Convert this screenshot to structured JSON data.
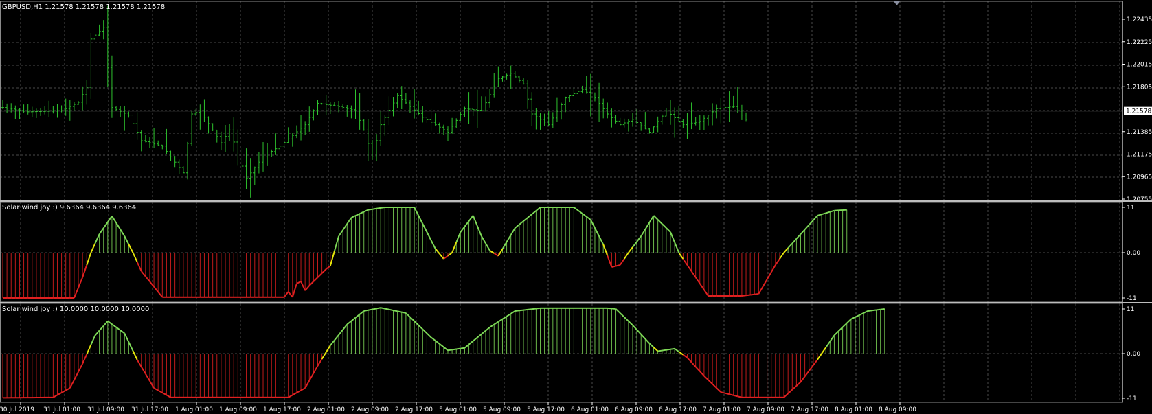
{
  "header": {
    "symbol_line": "GBPUSD,H1  1.21578 1.21578 1.21578 1.21578"
  },
  "colors": {
    "background": "#000000",
    "grid": "#4a4a4a",
    "price_bar": "#2ec42e",
    "positive": "#7ed957",
    "negative": "#e02020",
    "transition": "#e6e60a",
    "axis_text": "#ffffff",
    "price_tag_bg": "#ffffff",
    "price_tag_text": "#000000"
  },
  "price_panel": {
    "current_price": "1.21578",
    "price_ticks": [
      "1.22435",
      "1.22225",
      "1.22015",
      "1.21805",
      "1.21385",
      "1.21175",
      "1.20965",
      "1.20755"
    ]
  },
  "indicator_panels": [
    {
      "label": "Solar wind joy :) 9.6364 9.6364 9.6364",
      "ticks": [
        "11",
        "0.00",
        "-11"
      ]
    },
    {
      "label": "Solar wind joy :) 10.0000 10.0000 10.0000",
      "ticks": [
        "11",
        "0.00",
        "-11"
      ]
    }
  ],
  "time_axis": {
    "labels": [
      "30 Jul 2019",
      "31 Jul 01:00",
      "31 Jul 09:00",
      "31 Jul 17:00",
      "1 Aug 01:00",
      "1 Aug 09:00",
      "1 Aug 17:00",
      "2 Aug 01:00",
      "2 Aug 09:00",
      "2 Aug 17:00",
      "5 Aug 01:00",
      "5 Aug 09:00",
      "5 Aug 17:00",
      "6 Aug 01:00",
      "6 Aug 09:00",
      "6 Aug 17:00",
      "7 Aug 01:00",
      "7 Aug 09:00",
      "7 Aug 17:00",
      "8 Aug 01:00",
      "8 Aug 09:00"
    ]
  },
  "chart_data": [
    {
      "type": "bar",
      "subtype": "ohlc",
      "symbol": "GBPUSD",
      "timeframe": "H1",
      "ylim": [
        1.20755,
        1.22435
      ],
      "y_ticks": [
        1.22435,
        1.22225,
        1.22015,
        1.21805,
        1.21578,
        1.21385,
        1.21175,
        1.20965,
        1.20755
      ],
      "close_path": [
        [
          0,
          1.2161
        ],
        [
          6,
          1.2157
        ],
        [
          14,
          1.2158
        ],
        [
          18,
          1.2166
        ],
        [
          20,
          1.218
        ],
        [
          21,
          1.2225
        ],
        [
          24,
          1.2236
        ],
        [
          26,
          1.2161
        ],
        [
          30,
          1.2154
        ],
        [
          33,
          1.213
        ],
        [
          38,
          1.2125
        ],
        [
          43,
          1.21
        ],
        [
          45,
          1.2155
        ],
        [
          47,
          1.2158
        ],
        [
          52,
          1.2128
        ],
        [
          54,
          1.214
        ],
        [
          58,
          1.2095
        ],
        [
          62,
          1.2115
        ],
        [
          66,
          1.2125
        ],
        [
          72,
          1.2145
        ],
        [
          75,
          1.2165
        ],
        [
          80,
          1.2162
        ],
        [
          84,
          1.2158
        ],
        [
          86,
          1.214
        ],
        [
          88,
          1.2115
        ],
        [
          90,
          1.2145
        ],
        [
          94,
          1.2172
        ],
        [
          100,
          1.2152
        ],
        [
          106,
          1.2138
        ],
        [
          110,
          1.216
        ],
        [
          114,
          1.2158
        ],
        [
          118,
          1.2188
        ],
        [
          121,
          1.2193
        ],
        [
          124,
          1.2183
        ],
        [
          126,
          1.2155
        ],
        [
          130,
          1.2145
        ],
        [
          134,
          1.217
        ],
        [
          138,
          1.2178
        ],
        [
          141,
          1.217
        ],
        [
          144,
          1.2155
        ],
        [
          147,
          1.2145
        ],
        [
          150,
          1.215
        ],
        [
          154,
          1.2138
        ],
        [
          158,
          1.2158
        ],
        [
          162,
          1.2145
        ],
        [
          166,
          1.2148
        ],
        [
          170,
          1.216
        ],
        [
          174,
          1.2162
        ],
        [
          177,
          1.215
        ]
      ]
    },
    {
      "type": "area",
      "name": "Solar wind joy :)",
      "ylim": [
        -11,
        11
      ],
      "last_value": 9.6364,
      "points": [
        [
          0,
          -11
        ],
        [
          17,
          -11
        ],
        [
          19,
          -6
        ],
        [
          21,
          0
        ],
        [
          23,
          4.5
        ],
        [
          26,
          8.9
        ],
        [
          29,
          4
        ],
        [
          31,
          0
        ],
        [
          33,
          -4.5
        ],
        [
          38,
          -10.8
        ],
        [
          67,
          -10.8
        ],
        [
          68,
          -9.5
        ],
        [
          69,
          -10.8
        ],
        [
          70,
          -7.5
        ],
        [
          71,
          -7
        ],
        [
          72,
          -9.2
        ],
        [
          73,
          -8
        ],
        [
          75,
          -6
        ],
        [
          77,
          -4
        ],
        [
          78,
          -3.2
        ],
        [
          80,
          4
        ],
        [
          83,
          8.5
        ],
        [
          87,
          10.4
        ],
        [
          91,
          11
        ],
        [
          98,
          11
        ],
        [
          100,
          7
        ],
        [
          103,
          1
        ],
        [
          105,
          -1.5
        ],
        [
          107,
          0
        ],
        [
          109,
          5
        ],
        [
          112,
          9
        ],
        [
          114,
          4
        ],
        [
          116,
          0.5
        ],
        [
          118,
          -0.8
        ],
        [
          122,
          6
        ],
        [
          128,
          11
        ],
        [
          136,
          11
        ],
        [
          140,
          8
        ],
        [
          143,
          2
        ],
        [
          145,
          -3.5
        ],
        [
          147,
          -3
        ],
        [
          149,
          0
        ],
        [
          152,
          4
        ],
        [
          155,
          9
        ],
        [
          159,
          5
        ],
        [
          161,
          0
        ],
        [
          165,
          -6
        ],
        [
          168,
          -10.5
        ],
        [
          172,
          -10.5
        ],
        [
          176,
          -10.5
        ],
        [
          180,
          -10
        ],
        [
          184,
          -3
        ],
        [
          186,
          0
        ],
        [
          190,
          4.5
        ],
        [
          194,
          9
        ],
        [
          198,
          10.2
        ],
        [
          201,
          10.4
        ]
      ]
    },
    {
      "type": "area",
      "name": "Solar wind joy :)",
      "ylim": [
        -11,
        11
      ],
      "last_value": 10,
      "points": [
        [
          0,
          -10.9
        ],
        [
          12,
          -10.8
        ],
        [
          16,
          -8.5
        ],
        [
          19,
          -2.5
        ],
        [
          22,
          4.5
        ],
        [
          25,
          8
        ],
        [
          29,
          5
        ],
        [
          32,
          -1.5
        ],
        [
          36,
          -8.5
        ],
        [
          40,
          -10.8
        ],
        [
          68,
          -10.8
        ],
        [
          72,
          -8.5
        ],
        [
          75,
          -3
        ],
        [
          78,
          2
        ],
        [
          82,
          7.2
        ],
        [
          86,
          10.5
        ],
        [
          90,
          11.3
        ],
        [
          96,
          10
        ],
        [
          102,
          4
        ],
        [
          106,
          0.8
        ],
        [
          110,
          1.4
        ],
        [
          116,
          6.5
        ],
        [
          122,
          10.5
        ],
        [
          128,
          11.2
        ],
        [
          144,
          11.2
        ],
        [
          146,
          11
        ],
        [
          150,
          7
        ],
        [
          154,
          2.5
        ],
        [
          156,
          0.6
        ],
        [
          160,
          1.2
        ],
        [
          163,
          -1
        ],
        [
          167,
          -5.5
        ],
        [
          171,
          -9.5
        ],
        [
          176,
          -10.8
        ],
        [
          186,
          -10.8
        ],
        [
          190,
          -7
        ],
        [
          194,
          -1.5
        ],
        [
          198,
          4.5
        ],
        [
          202,
          8.5
        ],
        [
          206,
          10.5
        ],
        [
          210,
          11
        ]
      ]
    }
  ]
}
